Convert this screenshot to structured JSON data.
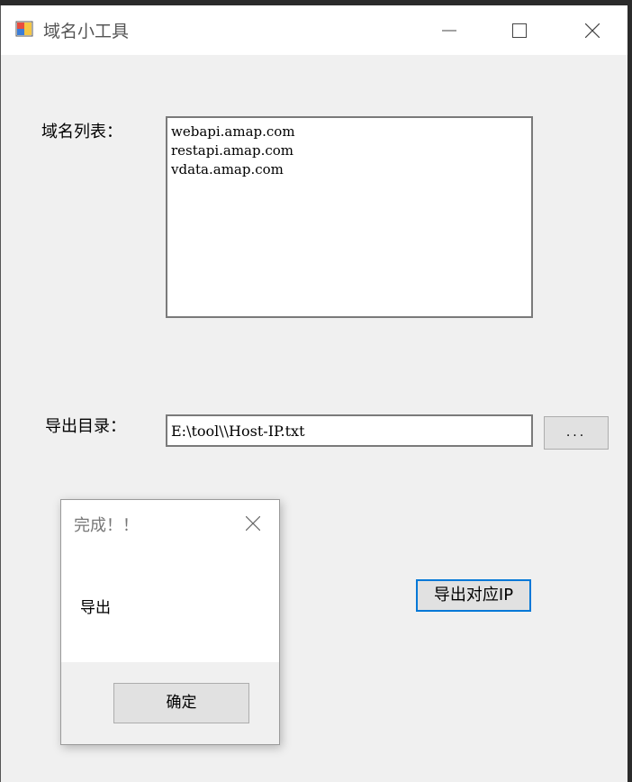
{
  "window": {
    "title": "域名小工具",
    "icon": "winforms-app-icon",
    "controls": {
      "minimize": "minimize-icon",
      "maximize": "maximize-icon",
      "close": "close-icon"
    }
  },
  "form": {
    "domain_list_label": "域名列表：",
    "domains": [
      "webapi.amap.com",
      "restapi.amap.com",
      "vdata.amap.com"
    ],
    "export_dir_label": "导出目录：",
    "export_path_value": "E:\\tool\\\\Host-IP.txt",
    "browse_label": "...",
    "export_button_label": "导出对应IP",
    "accent_color": "#0078d7"
  },
  "dialog": {
    "title": "完成！！",
    "message": "导出",
    "ok_label": "确定"
  }
}
